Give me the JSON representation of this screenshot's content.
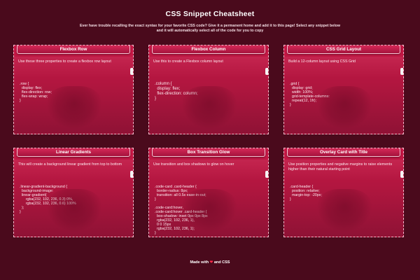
{
  "page": {
    "title": "CSS Snippet Cheatsheet",
    "intro": "Ever have trouble recalling the exact syntax for your favorite CSS code? Give it a permanent home and add it to this page! Select any snippet below and it will automatically select all of the code for you to copy"
  },
  "cards": [
    {
      "title": "Flexbox Row",
      "description": "Use these three properties to create a flexbox row layout",
      "code": ".row {\n  display: flex;\n  flex-direction: row;\n  flex-wrap: wrap;\n}"
    },
    {
      "title": "Flexbox Column",
      "description": "Use this to create a Flexbox column layout",
      "code": ".column {\n  display: flex;\n  flex-direction: column;\n}"
    },
    {
      "title": "CSS Grid Layout",
      "description": "Build a 12-column layout using CSS Grid",
      "code": ".grid {\n  display: grid;\n  width: 100%;\n  grid-template-columns:\n  repeat(12, 1fr);\n}"
    },
    {
      "title": "Linear Gradients",
      "description": "This will create a background linear gradient from top to bottom",
      "code": ".linear-gradient-background {\n  background-image:\n  linear-gradient(\n      rgba(232, 102, 236, 0.3) 0%,\n      rgba(232, 102, 236, 0.6) 100%\n  );\n}"
    },
    {
      "title": "Box Transition Glow",
      "description": "Use transition and box shadows to glow on hover",
      "code": ".code-card .card-header {\n  border-radius: 8px;\n  transition: all 0.5s ease-in-out;\n}\n\n.code-card:hover,\n.code-card:hover .card-header {\n  box-shadow: inset 0px 0px 8px\n  rgba(232, 102, 236, 1),\n  0 0 15px\n  rgba(232, 102, 236, 1);\n}"
    },
    {
      "title": "Overlay Card with Title",
      "description": "Use position properties and negative margins to raise elements higher than their natural starting point",
      "code": ".card-header {\n  position: relative;\n  margin-top: -20px;\n}"
    }
  ],
  "footer": {
    "prefix": "Made with",
    "heart": "❤",
    "suffix": "and CSS"
  },
  "colors": {
    "background": "#4a0a1c",
    "card": "#b0163f",
    "heart": "#ff2a4a"
  }
}
